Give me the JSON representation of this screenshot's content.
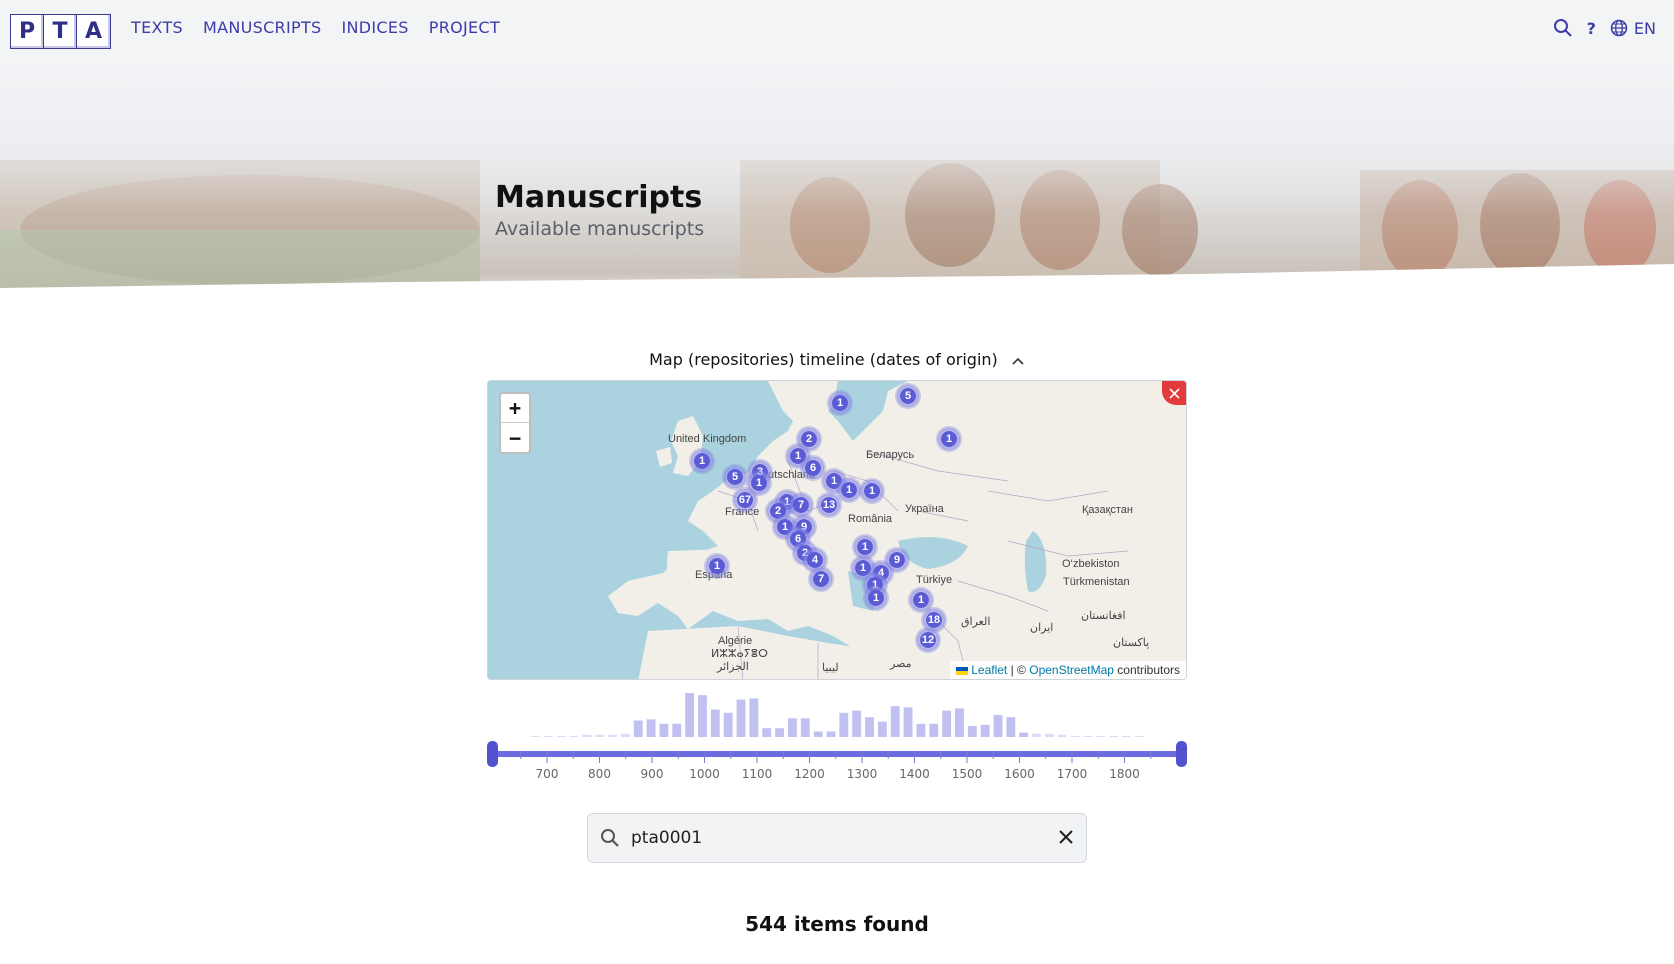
{
  "logo": {
    "letters": [
      "P",
      "T",
      "A"
    ]
  },
  "nav": {
    "items": [
      {
        "label": "TEXTS"
      },
      {
        "label": "MANUSCRIPTS"
      },
      {
        "label": "INDICES"
      },
      {
        "label": "PROJECT"
      }
    ],
    "help_label": "?",
    "lang_label": "EN",
    "icons": [
      "search-icon",
      "globe-icon"
    ]
  },
  "hero": {
    "title": "Manuscripts",
    "subtitle": "Available manuscripts"
  },
  "map_section": {
    "toggle_label": "Map (repositories) timeline (dates of origin)",
    "zoom_in": "+",
    "zoom_out": "−",
    "close_icon": "close-icon",
    "attribution": {
      "leaflet": "Leaflet",
      "sep": "| ©",
      "osm": "OpenStreetMap",
      "tail": "contributors"
    },
    "country_labels": [
      "United Kingdom",
      "Deutschland",
      "Беларусь",
      "France",
      "România",
      "Україна",
      "Қазақстан",
      "O‘zbekiston",
      "Türkmenistan",
      "España",
      "Türkiye",
      "افغانستان",
      "ایران",
      "العراق",
      "Algérie",
      "ⵍⵣⵣⴰⵢⴻⵔ",
      "الجزائر",
      "ليبيا",
      "مصر",
      "پاکستان"
    ],
    "clusters": [
      "1",
      "5",
      "1",
      "2",
      "1",
      "1",
      "5",
      "3",
      "1",
      "6",
      "1",
      "1",
      "1",
      "67",
      "1",
      "7",
      "13",
      "2",
      "1",
      "9",
      "6",
      "2",
      "4",
      "7",
      "1",
      "1",
      "9",
      "4",
      "1",
      "1",
      "1",
      "1",
      "18",
      "12"
    ]
  },
  "timeline": {
    "tick_labels": [
      "700",
      "800",
      "900",
      "1000",
      "1100",
      "1200",
      "1300",
      "1400",
      "1500",
      "1600",
      "1700",
      "1800"
    ],
    "accent": "#5b5bd6",
    "histogram": [
      1,
      1,
      1,
      1,
      2,
      2,
      2,
      3,
      15,
      16,
      12,
      12,
      40,
      38,
      25,
      22,
      34,
      35,
      8,
      8,
      17,
      17,
      5,
      5,
      22,
      24,
      18,
      14,
      28,
      27,
      12,
      12,
      24,
      26,
      10,
      11,
      20,
      18,
      4,
      3,
      3,
      2,
      1,
      1,
      1,
      1,
      1,
      1
    ]
  },
  "search": {
    "value": "pta0001",
    "icon": "search-icon",
    "clear_icon": "close-icon"
  },
  "results": {
    "count_label": "544 items found"
  }
}
